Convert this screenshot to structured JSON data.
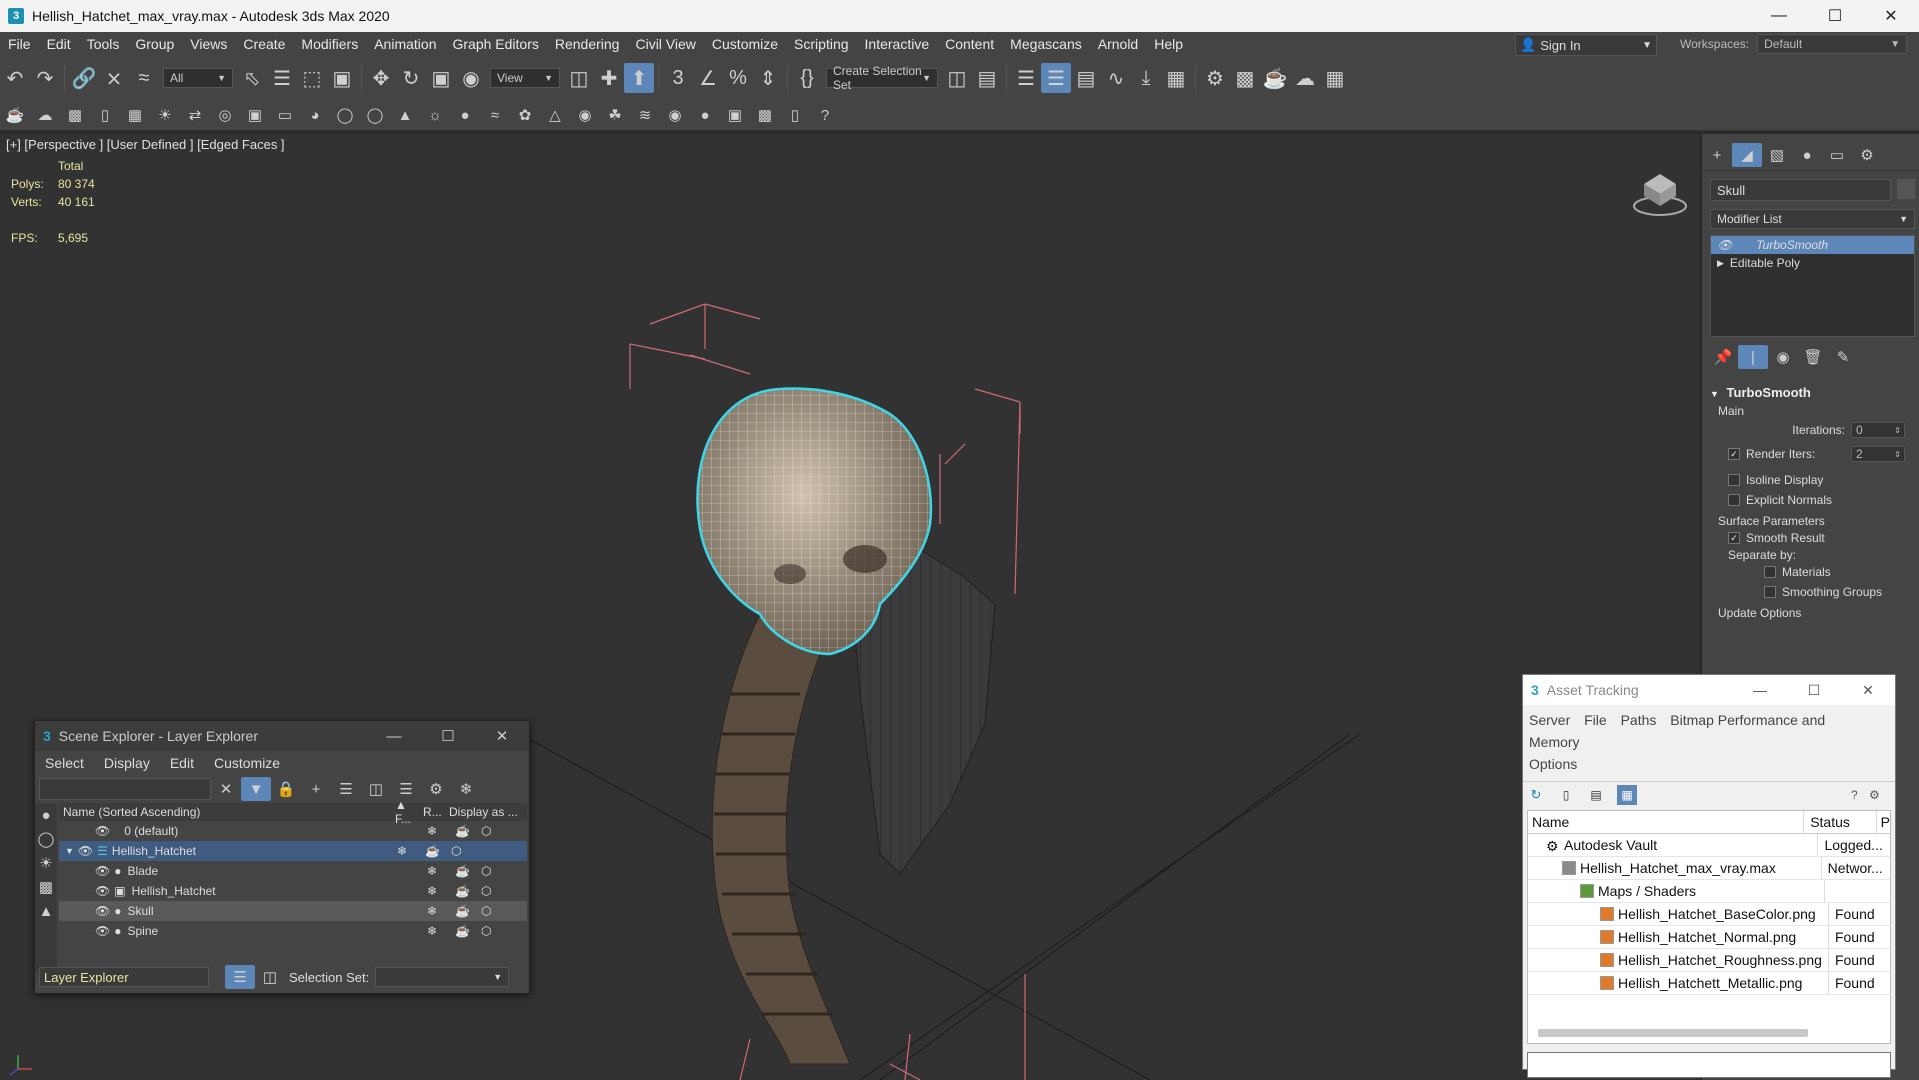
{
  "window": {
    "title": "Hellish_Hatchet_max_vray.max - Autodesk 3ds Max 2020",
    "app_icon": "3",
    "controls": [
      "minimize-icon",
      "maximize-icon",
      "close-icon"
    ]
  },
  "menu": [
    "File",
    "Edit",
    "Tools",
    "Group",
    "Views",
    "Create",
    "Modifiers",
    "Animation",
    "Graph Editors",
    "Rendering",
    "Civil View",
    "Customize",
    "Scripting",
    "Interactive",
    "Content",
    "Megascans",
    "Arnold",
    "Help"
  ],
  "signin": {
    "label": "Sign In"
  },
  "workspaces": {
    "label": "Workspaces:",
    "value": "Default"
  },
  "toolbar": {
    "filter_value": "All",
    "ref_coord_value": "View",
    "selection_set_placeholder": "Create Selection Set"
  },
  "viewport": {
    "label": "[+] [Perspective ] [User Defined ] [Edged Faces ]",
    "stats": {
      "total_label": "Total",
      "polys_label": "Polys:",
      "polys": "80 374",
      "verts_label": "Verts:",
      "verts": "40 161",
      "fps_label": "FPS:",
      "fps": "5,695"
    }
  },
  "command_panel": {
    "object_name": "Skull",
    "modifier_list_label": "Modifier List",
    "stack": [
      {
        "label": "TurboSmooth",
        "selected": true
      },
      {
        "label": "Editable Poly",
        "selected": false
      }
    ],
    "rollout_title": "TurboSmooth",
    "main_label": "Main",
    "iterations_label": "Iterations:",
    "iterations_value": "0",
    "render_iters_label": "Render Iters:",
    "render_iters_value": "2",
    "render_iters_checked": true,
    "isoline_label": "Isoline Display",
    "explicit_normals_label": "Explicit Normals",
    "surface_params_label": "Surface Parameters",
    "smooth_result_label": "Smooth Result",
    "separate_by_label": "Separate by:",
    "materials_label": "Materials",
    "smoothing_groups_label": "Smoothing Groups",
    "update_options_label": "Update Options"
  },
  "scene_explorer": {
    "title": "Scene Explorer - Layer Explorer",
    "menu": [
      "Select",
      "Display",
      "Edit",
      "Customize"
    ],
    "columns": {
      "name": "Name (Sorted Ascending)",
      "f": "▲ F...",
      "r": "R...",
      "display": "Display as ..."
    },
    "rows": [
      {
        "label": "0 (default)",
        "indent": 0,
        "selected": false
      },
      {
        "label": "Hellish_Hatchet",
        "indent": 0,
        "selected": true
      },
      {
        "label": "Blade",
        "indent": 1,
        "selected": false
      },
      {
        "label": "Hellish_Hatchet",
        "indent": 1,
        "selected": false
      },
      {
        "label": "Skull",
        "indent": 1,
        "selected": false,
        "highlight": true
      },
      {
        "label": "Spine",
        "indent": 1,
        "selected": false
      }
    ],
    "footer_explorer": "Layer Explorer",
    "selection_set_label": "Selection Set:"
  },
  "asset_tracking": {
    "title": "Asset Tracking",
    "menu": [
      "Server",
      "File",
      "Paths",
      "Bitmap Performance and Memory",
      "Options"
    ],
    "columns": {
      "name": "Name",
      "status": "Status",
      "extra": "P"
    },
    "rows": [
      {
        "name": "Autodesk Vault",
        "status": "Logged...",
        "indent": 0,
        "icon": "vault-icon"
      },
      {
        "name": "Hellish_Hatchet_max_vray.max",
        "status": "Networ...",
        "indent": 1,
        "icon": "max-file-icon"
      },
      {
        "name": "Maps / Shaders",
        "status": "",
        "indent": 2,
        "icon": "maps-folder-icon"
      },
      {
        "name": "Hellish_Hatchet_BaseColor.png",
        "status": "Found",
        "indent": 3,
        "icon": "image-file-icon"
      },
      {
        "name": "Hellish_Hatchet_Normal.png",
        "status": "Found",
        "indent": 3,
        "icon": "image-file-icon"
      },
      {
        "name": "Hellish_Hatchet_Roughness.png",
        "status": "Found",
        "indent": 3,
        "icon": "image-file-icon"
      },
      {
        "name": "Hellish_Hatchett_Metallic.png",
        "status": "Found",
        "indent": 3,
        "icon": "image-file-icon"
      }
    ]
  },
  "colors": {
    "accent": "#5d87b8",
    "selection_outline": "#3fd6e8",
    "bbox": "#d06a78",
    "stats_text": "#e8e4a0"
  }
}
